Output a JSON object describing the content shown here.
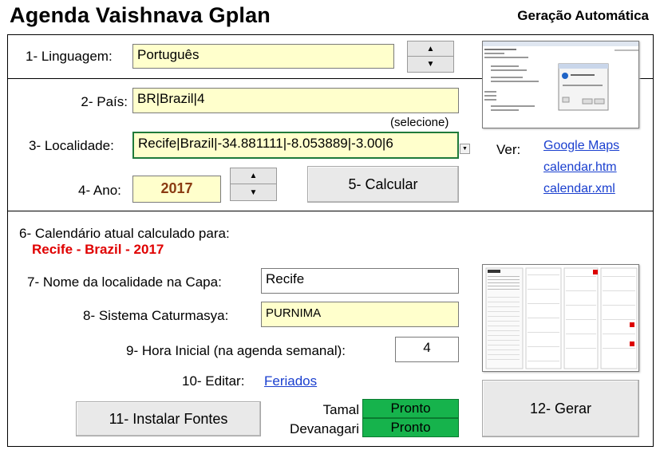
{
  "header": {
    "title": "Agenda Vaishnava Gplan",
    "subtitle": "Geração Automática"
  },
  "language": {
    "label": "1- Linguagem:",
    "value": "Português"
  },
  "country": {
    "label": "2- País:",
    "value": "BR|Brazil|4",
    "hint": "(selecione)"
  },
  "locality": {
    "label": "3- Localidade:",
    "value": "Recife|Brazil|-34.881111|-8.053889|-3.00|6"
  },
  "year": {
    "label": "4- Ano:",
    "value": "2017"
  },
  "calculate_button": "5- Calcular",
  "view": {
    "label": "Ver:",
    "links": [
      "Google Maps",
      "calendar.htm",
      "calendar.xml"
    ]
  },
  "current_calendar": {
    "label": "6- Calendário atual calculado para:",
    "value": "Recife - Brazil - 2017"
  },
  "cover_name": {
    "label": "7- Nome da localidade na Capa:",
    "value": "Recife"
  },
  "caturmasya": {
    "label": "8- Sistema Caturmasya:",
    "value": "PURNIMA"
  },
  "start_hour": {
    "label": "9- Hora Inicial (na agenda semanal):",
    "value": "4"
  },
  "edit": {
    "label": "10- Editar:",
    "link": "Feriados"
  },
  "install_fonts_button": "11- Instalar Fontes",
  "fonts": [
    {
      "name": "Tamal",
      "status": "Pronto"
    },
    {
      "name": "Devanagari",
      "status": "Pronto"
    }
  ],
  "generate_button": "12- Gerar",
  "colors": {
    "field_bg": "#ffffcc",
    "status_green": "#16b34c",
    "link_blue": "#1a3fcf",
    "accent_red": "#e00000"
  }
}
